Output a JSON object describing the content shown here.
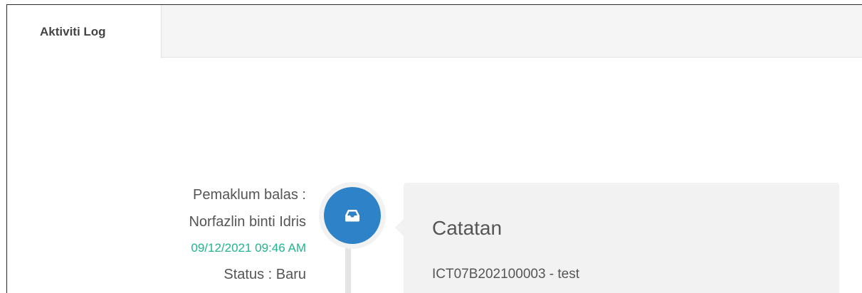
{
  "tabs": [
    {
      "label": "Aktiviti Log",
      "active": true
    }
  ],
  "timeline": {
    "entry": {
      "replied_by_label": "Pemaklum balas :",
      "replied_by_name": "Norfazlin binti Idris",
      "datetime": "09/12/2021 09:46 AM",
      "status": "Status : Baru",
      "icon": "inbox-icon",
      "card_title": "Catatan",
      "card_body": "ICT07B202100003 - test"
    }
  },
  "colors": {
    "accent_blue": "#2d82c8",
    "date_green": "#1fb58f",
    "card_bg": "#f2f2f2"
  }
}
